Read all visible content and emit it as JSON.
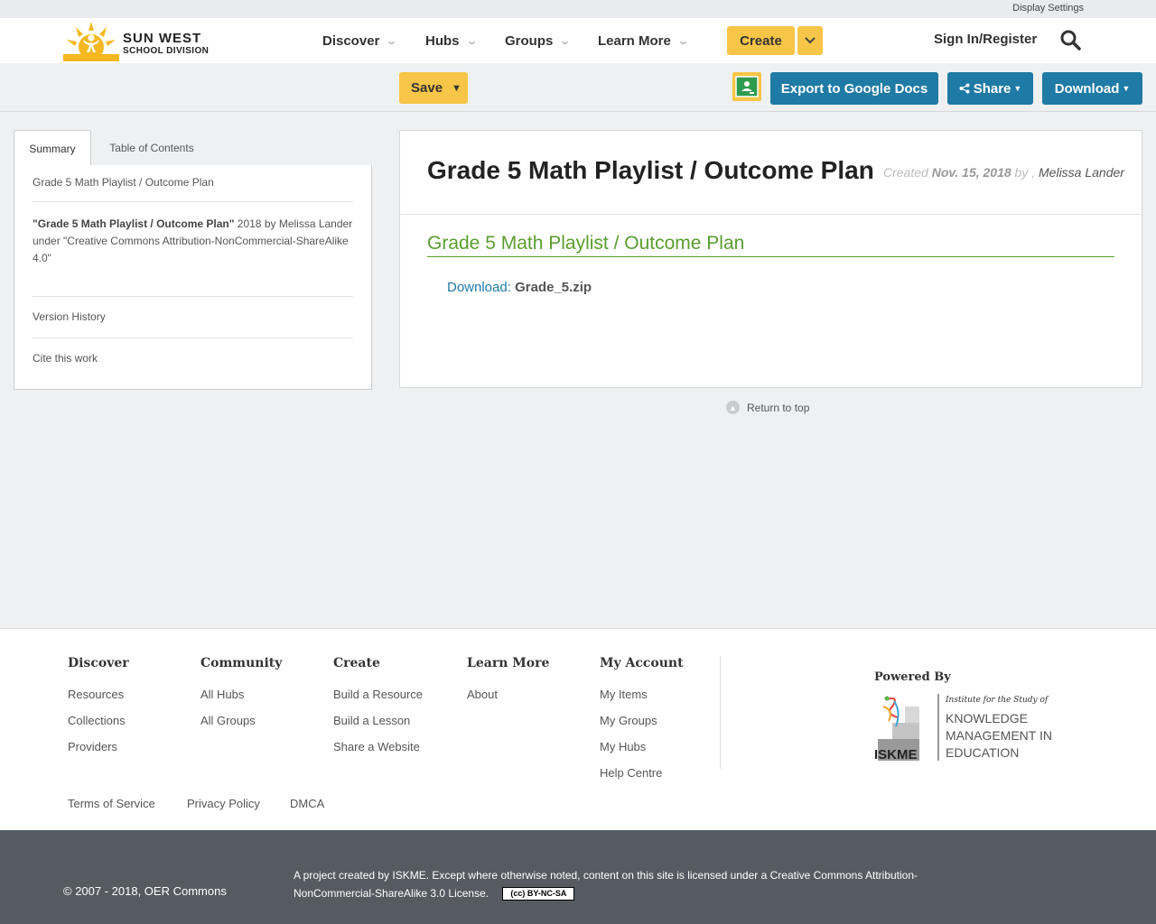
{
  "topbar": {
    "display_settings": "Display Settings"
  },
  "logo": {
    "line1": "SUN WEST",
    "line2": "SCHOOL DIVISION"
  },
  "nav": {
    "items": [
      {
        "label": "Discover"
      },
      {
        "label": "Hubs"
      },
      {
        "label": "Groups"
      },
      {
        "label": "Learn More"
      }
    ],
    "create": "Create",
    "signin": "Sign In/Register"
  },
  "toolbar": {
    "save": "Save",
    "export": "Export to Google Docs",
    "share": "Share",
    "download": "Download"
  },
  "sidebar": {
    "tabs": [
      "Summary",
      "Table of Contents"
    ],
    "title_link": "Grade 5 Math Playlist / Outcome Plan",
    "attr_title": "\"Grade 5 Math Playlist / Outcome Plan\"",
    "attr_rest": " 2018 by Melissa Lander",
    "attr_license": "under \"Creative Commons Attribution-NonCommercial-ShareAlike 4.0\"",
    "version_history": "Version History",
    "cite": "Cite this work"
  },
  "main": {
    "title": "Grade 5 Math Playlist / Outcome Plan",
    "created_label": "Created",
    "created_date": "Nov. 15, 2018",
    "by_label": "by ,",
    "author": "Melissa Lander",
    "section_title": "Grade 5 Math Playlist / Outcome Plan",
    "download_label": "Download:",
    "download_file": "Grade_5.zip"
  },
  "return_to_top": "Return to top",
  "footer": {
    "columns": [
      {
        "heading": "Discover",
        "links": [
          "Resources",
          "Collections",
          "Providers"
        ]
      },
      {
        "heading": "Community",
        "links": [
          "All Hubs",
          "All Groups"
        ]
      },
      {
        "heading": "Create",
        "links": [
          "Build a Resource",
          "Build a Lesson",
          "Share a Website"
        ]
      },
      {
        "heading": "Learn More",
        "links": [
          "About"
        ]
      },
      {
        "heading": "My Account",
        "links": [
          "My Items",
          "My Groups",
          "My Hubs",
          "Help Centre"
        ]
      }
    ],
    "powered_by": "Powered By",
    "iskme": {
      "tagline": "Institute for the Study of",
      "line1": "KNOWLEDGE",
      "line2": "MANAGEMENT IN",
      "line3": "EDUCATION",
      "mark": "ISKME"
    },
    "legal": [
      "Terms of Service",
      "Privacy Policy",
      "DMCA"
    ]
  },
  "bottom": {
    "copyright": "© 2007 - 2018, OER Commons",
    "license_text": "A project created by ISKME. Except where otherwise noted, content on this site is licensed under a Creative Commons Attribution-NonCommercial-ShareAlike 3.0 License.",
    "cc_badge": "(cc) BY-NC-SA"
  },
  "colors": {
    "accent_yellow": "#f7c547",
    "button_blue": "#1f7aa5",
    "heading_green": "#5a9e2f",
    "footer_dark": "#555b61"
  }
}
